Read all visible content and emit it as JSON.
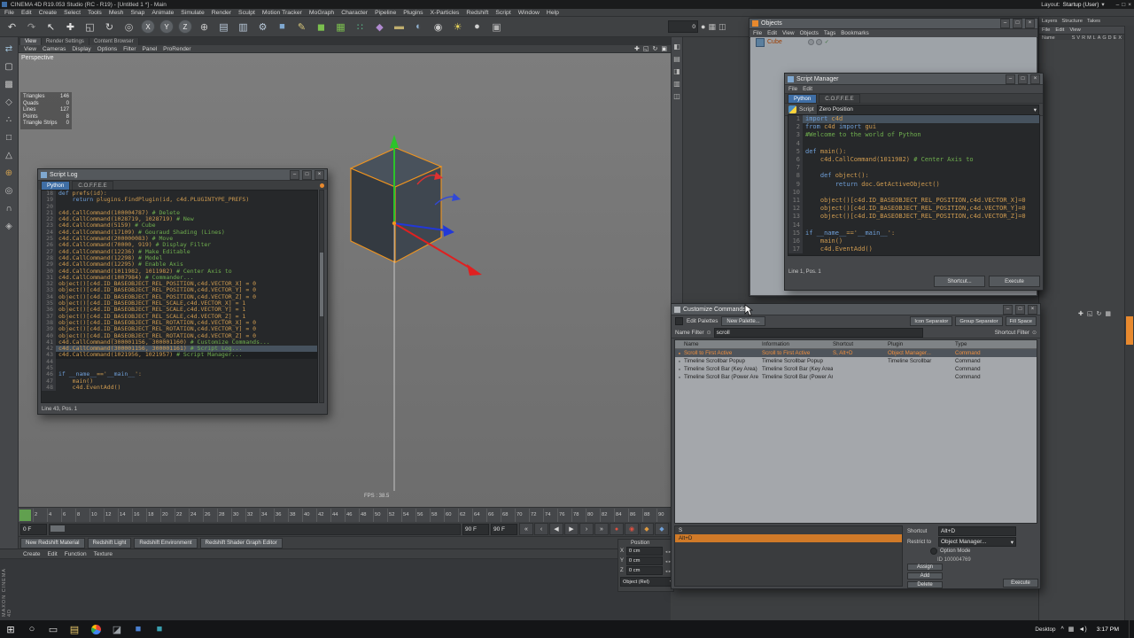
{
  "chrome": {
    "min": "–",
    "max": "□",
    "close": "×",
    "dropdown": "▾",
    "filter_icon": "⊙"
  },
  "titlebar": {
    "title": "CINEMA 4D R19.053 Studio (RC - R19) - [Untitled 1 *] - Main",
    "layout_label": "Layout:",
    "layout_value": "Startup (User)"
  },
  "menubar": {
    "items": [
      "File",
      "Edit",
      "Create",
      "Select",
      "Tools",
      "Mesh",
      "Snap",
      "Animate",
      "Simulate",
      "Render",
      "Sculpt",
      "Motion Tracker",
      "MoGraph",
      "Character",
      "Pipeline",
      "Plugins",
      "X-Particles",
      "Redshift",
      "Script",
      "Window",
      "Help"
    ]
  },
  "toolbar": {
    "icons": [
      {
        "name": "undo-icon",
        "glyph": "↶",
        "color": "#d8d8d8"
      },
      {
        "name": "redo-icon",
        "glyph": "↷",
        "color": "#9a9a9a"
      },
      {
        "name": "live-selection-icon",
        "glyph": "↖",
        "color": "#e8e8e8"
      },
      {
        "name": "move-tool-icon",
        "glyph": "✚",
        "color": "#e0e0e0"
      },
      {
        "name": "scale-tool-icon",
        "glyph": "◱",
        "color": "#d0d0d0"
      },
      {
        "name": "rotate-tool-icon",
        "glyph": "↻",
        "color": "#d0d0d0"
      },
      {
        "name": "last-tool-icon",
        "glyph": "◎",
        "color": "#c0c0c0"
      },
      {
        "name": "x-axis-toggle",
        "glyph": "X",
        "color": "#ececec",
        "cls": "round"
      },
      {
        "name": "y-axis-toggle",
        "glyph": "Y",
        "color": "#ececec",
        "cls": "round"
      },
      {
        "name": "z-axis-toggle",
        "glyph": "Z",
        "color": "#ececec",
        "cls": "round"
      },
      {
        "name": "coordinate-system-icon",
        "glyph": "⊕",
        "color": "#c8c8c8"
      },
      {
        "name": "render-view-icon",
        "glyph": "▤",
        "color": "#b8c8d8"
      },
      {
        "name": "render-picture-viewer-icon",
        "glyph": "▥",
        "color": "#b8c8d8"
      },
      {
        "name": "render-settings-icon",
        "glyph": "⚙",
        "color": "#b8c8d8"
      },
      {
        "name": "add-cube-icon",
        "glyph": "■",
        "color": "#7fa8d0"
      },
      {
        "name": "pen-tool-icon",
        "glyph": "✎",
        "color": "#d8c87a"
      },
      {
        "name": "subdivision-surface-icon",
        "glyph": "◼",
        "color": "#7bbf4e"
      },
      {
        "name": "array-generator-icon",
        "glyph": "▦",
        "color": "#7bbf4e"
      },
      {
        "name": "mograph-cloner-icon",
        "glyph": "∷",
        "color": "#5abf8e"
      },
      {
        "name": "deformer-icon",
        "glyph": "◆",
        "color": "#b08ad0"
      },
      {
        "name": "floor-object-icon",
        "glyph": "▬",
        "color": "#bfae6e"
      },
      {
        "name": "sky-object-icon",
        "glyph": "◐",
        "color": "#8fb0cf"
      },
      {
        "name": "camera-object-icon",
        "glyph": "◉",
        "color": "#c8c8c8"
      },
      {
        "name": "light-object-icon",
        "glyph": "☀",
        "color": "#e8d45a"
      },
      {
        "name": "material-icon",
        "glyph": "●",
        "color": "#d0d0d0"
      },
      {
        "name": "display-filter-icon",
        "glyph": "▣",
        "color": "#b0b0b0"
      }
    ],
    "right_value": "0",
    "right_icons": [
      {
        "name": "render-sphere-icon",
        "glyph": "●",
        "color": "#cfcfcf"
      },
      {
        "name": "grid-toggle-icon",
        "glyph": "▦",
        "color": "#b8b8b8"
      },
      {
        "name": "layout-toggle-icon",
        "glyph": "◫",
        "color": "#b8b8b8"
      }
    ]
  },
  "mode_palette": {
    "icons": [
      {
        "name": "make-editable-icon",
        "glyph": "⇄",
        "color": "#9fc0d8"
      },
      {
        "name": "model-mode-icon",
        "glyph": "▢",
        "color": "#d0d0d0"
      },
      {
        "name": "texture-mode-icon",
        "glyph": "▩",
        "color": "#c0c0c0"
      },
      {
        "name": "workplane-mode-icon",
        "glyph": "◇",
        "color": "#c0c0c0"
      },
      {
        "name": "points-mode-icon",
        "glyph": "∴",
        "color": "#d0d0d0"
      },
      {
        "name": "edges-mode-icon",
        "glyph": "□",
        "color": "#d0d0d0"
      },
      {
        "name": "polygons-mode-icon",
        "glyph": "△",
        "color": "#d0d0d0"
      },
      {
        "name": "enable-axis-icon",
        "glyph": "⊕",
        "color": "#d0a050"
      },
      {
        "name": "viewport-solo-icon",
        "glyph": "◎",
        "color": "#c0c0c0"
      },
      {
        "name": "snap-toggle-icon",
        "glyph": "∩",
        "color": "#d0d0d0"
      },
      {
        "name": "workplane-lock-icon",
        "glyph": "◈",
        "color": "#b0b0b0"
      }
    ]
  },
  "side_palette": {
    "icons": [
      {
        "name": "panel-toggle-icon-1",
        "glyph": "◧",
        "color": "#b8b8b8"
      },
      {
        "name": "panel-toggle-icon-2",
        "glyph": "▤",
        "color": "#b8b8b8"
      },
      {
        "name": "panel-toggle-icon-3",
        "glyph": "◨",
        "color": "#b8b8b8"
      },
      {
        "name": "panel-toggle-icon-4",
        "glyph": "▥",
        "color": "#b8b8b8"
      },
      {
        "name": "panel-toggle-icon-5",
        "glyph": "◫",
        "color": "#b8b8b8"
      }
    ]
  },
  "dock_tabs": {
    "items": [
      {
        "label": "View",
        "cls": "active"
      },
      {
        "label": "Render Settings"
      },
      {
        "label": "Content Browser"
      }
    ]
  },
  "viewport": {
    "menu": [
      "View",
      "Cameras",
      "Display",
      "Options",
      "Filter",
      "Panel",
      "ProRender"
    ],
    "label": "Perspective",
    "stats": [
      {
        "label": "Triangles",
        "value": "146"
      },
      {
        "label": "Quads",
        "value": "0"
      },
      {
        "label": "Lines",
        "value": "127"
      },
      {
        "label": "Points",
        "value": "8"
      },
      {
        "label": "Triangle Strips",
        "value": "0"
      }
    ],
    "fps": "FPS : 38.5",
    "nav_icons": [
      {
        "name": "pan-view-icon",
        "glyph": "✚"
      },
      {
        "name": "zoom-view-icon",
        "glyph": "◱"
      },
      {
        "name": "rotate-view-icon",
        "glyph": "↻"
      },
      {
        "name": "toggle-view-icon",
        "glyph": "▣"
      }
    ]
  },
  "timeline": {
    "ticks": [
      "0",
      "2",
      "4",
      "6",
      "8",
      "10",
      "12",
      "14",
      "16",
      "18",
      "20",
      "22",
      "24",
      "26",
      "28",
      "30",
      "32",
      "34",
      "36",
      "38",
      "40",
      "42",
      "44",
      "46",
      "48",
      "50",
      "52",
      "54",
      "56",
      "58",
      "60",
      "62",
      "64",
      "66",
      "68",
      "70",
      "72",
      "74",
      "76",
      "78",
      "80",
      "82",
      "84",
      "86",
      "88",
      "90"
    ]
  },
  "playback": {
    "current": "0 F",
    "end": "90 F",
    "end2": "90 F",
    "transport": [
      {
        "name": "goto-start-button",
        "glyph": "«",
        "color": "#d8d8d8"
      },
      {
        "name": "prev-key-button",
        "glyph": "‹",
        "color": "#d8d8d8"
      },
      {
        "name": "prev-frame-button",
        "glyph": "◀",
        "color": "#d8d8d8"
      },
      {
        "name": "play-forward-button",
        "glyph": "▶",
        "color": "#d8d8d8"
      },
      {
        "name": "next-frame-button",
        "glyph": "›",
        "color": "#d8d8d8"
      },
      {
        "name": "goto-end-button",
        "glyph": "»",
        "color": "#d8d8d8"
      },
      {
        "name": "record-keyframe-button",
        "glyph": "●",
        "color": "#e05040"
      },
      {
        "name": "autokey-button",
        "glyph": "◉",
        "color": "#e05040"
      },
      {
        "name": "keyframe-mode-button",
        "glyph": "◆",
        "color": "#e09a40"
      },
      {
        "name": "playback-options-button",
        "glyph": "◆",
        "color": "#6fa0d8"
      }
    ]
  },
  "redshift_bar": {
    "buttons": [
      "New Redshift Material",
      "Redshift Light",
      "Redshift Environment",
      "Redshift Shader Graph Editor"
    ]
  },
  "material_manager": {
    "menu": [
      "Create",
      "Edit",
      "Function",
      "Texture"
    ]
  },
  "brand": {
    "vertical": "MAXON  CINEMA 4D"
  },
  "coordinates": {
    "title": "Position",
    "rows": [
      {
        "axis": "X",
        "value": "0 cm"
      },
      {
        "axis": "Y",
        "value": "0 cm"
      },
      {
        "axis": "Z",
        "value": "0 cm"
      }
    ],
    "mode": "Object (Rel)"
  },
  "objects_panel": {
    "title": "Objects",
    "menu": [
      "File",
      "Edit",
      "View",
      "Objects",
      "Tags",
      "Bookmarks"
    ],
    "item": "Cube",
    "state_check": "✓"
  },
  "layers_panel": {
    "tabs": [
      "Layers",
      "Structure",
      "Takes"
    ],
    "menu": [
      "File",
      "Edit",
      "View"
    ],
    "name_header": "Name",
    "flags": [
      "S",
      "V",
      "R",
      "M",
      "L",
      "A",
      "G",
      "D",
      "E",
      "X"
    ],
    "nav_icons": [
      {
        "name": "pan-view-icon",
        "glyph": "✚"
      },
      {
        "name": "zoom-view-icon",
        "glyph": "◱"
      },
      {
        "name": "rotate-view-icon",
        "glyph": "↻"
      },
      {
        "name": "toggle-view-icon",
        "glyph": "▦"
      }
    ]
  },
  "script_log": {
    "title": "Script Log",
    "tabs": [
      {
        "label": "Python",
        "cls": "active"
      },
      {
        "label": "C.O.F.F.E.E"
      }
    ],
    "status": "Line 43, Pos. 1",
    "lines": [
      {
        "n": 18,
        "t": "def prefs(id):"
      },
      {
        "n": 19,
        "t": "    return plugins.FindPlugin(id, c4d.PLUGINTYPE_PREFS)"
      },
      {
        "n": 20,
        "t": ""
      },
      {
        "n": 21,
        "t": "c4d.CallCommand(100004787) # Delete"
      },
      {
        "n": 22,
        "t": "c4d.CallCommand(1028719, 1028719) # New"
      },
      {
        "n": 23,
        "t": "c4d.CallCommand(5159) # Cube"
      },
      {
        "n": 24,
        "t": "c4d.CallCommand(17109) # Gouraud Shading (Lines)"
      },
      {
        "n": 25,
        "t": "c4d.CallCommand(200000083) # Move"
      },
      {
        "n": 26,
        "t": "c4d.CallCommand(70000, 919) # Display Filter"
      },
      {
        "n": 27,
        "t": "c4d.CallCommand(12236) # Make Editable"
      },
      {
        "n": 28,
        "t": "c4d.CallCommand(12298) # Model"
      },
      {
        "n": 29,
        "t": "c4d.CallCommand(12295) # Enable Axis"
      },
      {
        "n": 30,
        "t": "c4d.CallCommand(1011982, 1011982) # Center Axis to"
      },
      {
        "n": 31,
        "t": "c4d.CallCommand(1007984) # Commander..."
      },
      {
        "n": 32,
        "t": "object()[c4d.ID_BASEOBJECT_REL_POSITION,c4d.VECTOR_X] = 0"
      },
      {
        "n": 33,
        "t": "object()[c4d.ID_BASEOBJECT_REL_POSITION,c4d.VECTOR_Y] = 0"
      },
      {
        "n": 34,
        "t": "object()[c4d.ID_BASEOBJECT_REL_POSITION,c4d.VECTOR_Z] = 0"
      },
      {
        "n": 35,
        "t": "object()[c4d.ID_BASEOBJECT_REL_SCALE,c4d.VECTOR_X] = 1"
      },
      {
        "n": 36,
        "t": "object()[c4d.ID_BASEOBJECT_REL_SCALE,c4d.VECTOR_Y] = 1"
      },
      {
        "n": 37,
        "t": "object()[c4d.ID_BASEOBJECT_REL_SCALE,c4d.VECTOR_Z] = 1"
      },
      {
        "n": 38,
        "t": "object()[c4d.ID_BASEOBJECT_REL_ROTATION,c4d.VECTOR_X] = 0"
      },
      {
        "n": 39,
        "t": "object()[c4d.ID_BASEOBJECT_REL_ROTATION,c4d.VECTOR_Y] = 0"
      },
      {
        "n": 40,
        "t": "object()[c4d.ID_BASEOBJECT_REL_ROTATION,c4d.VECTOR_Z] = 0"
      },
      {
        "n": 41,
        "t": "c4d.CallCommand(300001156, 300001160) # Customize Commands..."
      },
      {
        "n": 42,
        "t": "c4d.CallCommand(300001156, 300001161) # Script Log...",
        "cls": "sel"
      },
      {
        "n": 43,
        "t": "c4d.CallCommand(1021956, 1021957) # Script Manager...",
        "cls": "cur"
      },
      {
        "n": 44,
        "t": ""
      },
      {
        "n": 45,
        "t": ""
      },
      {
        "n": 46,
        "t": "if __name__=='__main__':"
      },
      {
        "n": 47,
        "t": "    main()"
      },
      {
        "n": 48,
        "t": "    c4d.EventAdd()"
      }
    ]
  },
  "script_manager": {
    "title": "Script Manager",
    "menu": [
      "File",
      "Edit"
    ],
    "tabs": [
      {
        "label": "Python",
        "cls": "active"
      },
      {
        "label": "C.O.F.F.E.E"
      }
    ],
    "script_label": "Script",
    "script_name": "Zero Position",
    "status": "Line 1, Pos. 1",
    "shortcut_btn": "Shortcut...",
    "execute_btn": "Execute",
    "lines": [
      {
        "n": 1,
        "t": "import c4d",
        "cls": "sel"
      },
      {
        "n": 2,
        "t": "from c4d import gui"
      },
      {
        "n": 3,
        "t": "#Welcome to the world of Python"
      },
      {
        "n": 4,
        "t": ""
      },
      {
        "n": 5,
        "t": "def main():"
      },
      {
        "n": 6,
        "t": "    c4d.CallCommand(1011982) # Center Axis to"
      },
      {
        "n": 7,
        "t": ""
      },
      {
        "n": 8,
        "t": "    def object():"
      },
      {
        "n": 9,
        "t": "        return doc.GetActiveObject()"
      },
      {
        "n": 10,
        "t": ""
      },
      {
        "n": 11,
        "t": "    object()[c4d.ID_BASEOBJECT_REL_POSITION,c4d.VECTOR_X]=0"
      },
      {
        "n": 12,
        "t": "    object()[c4d.ID_BASEOBJECT_REL_POSITION,c4d.VECTOR_Y]=0"
      },
      {
        "n": 13,
        "t": "    object()[c4d.ID_BASEOBJECT_REL_POSITION,c4d.VECTOR_Z]=0"
      },
      {
        "n": 14,
        "t": ""
      },
      {
        "n": 15,
        "t": "if __name__=='__main__':"
      },
      {
        "n": 16,
        "t": "    main()"
      },
      {
        "n": 17,
        "t": "    c4d.EventAdd()"
      }
    ]
  },
  "customize": {
    "title": "Customize Commands...",
    "edit_palettes_label": "Edit Palettes",
    "new_palette_btn": "New Palette...",
    "sep_buttons": [
      "Icon Separator",
      "Group Separator",
      "Fill Space"
    ],
    "name_filter_label": "Name Filter",
    "filter_value": "scroll",
    "shortcut_filter_label": "Shortcut Filter",
    "columns": [
      "Name",
      "Information",
      "Shortcut",
      "Plugin",
      "Type"
    ],
    "rows": [
      {
        "name": "Scroll to First Active",
        "info": "Scroll to First Active",
        "shortcut": "S, Alt+D",
        "plugin": "Object Manager...",
        "type": "Command",
        "cls": "selected"
      },
      {
        "name": "Timeline Scrollbar Popup",
        "info": "Timeline Scrollbar Popup",
        "shortcut": "",
        "plugin": "Timeline Scrollbar",
        "type": "Command"
      },
      {
        "name": "Timeline Scroll Bar (Key Area)",
        "info": "Timeline Scroll Bar (Key Area)",
        "shortcut": "",
        "plugin": "",
        "type": "Command"
      },
      {
        "name": "Timeline Scroll Bar (Power Are",
        "info": "Timeline Scroll Bar (Power Are",
        "shortcut": "",
        "plugin": "",
        "type": "Command"
      }
    ],
    "shortcut_list": [
      {
        "t": "S"
      },
      {
        "t": "Alt+D",
        "cls": "selected"
      }
    ],
    "shortcut_label": "Shortcut",
    "shortcut_value": "Alt+D",
    "restrict_label": "Restrict to",
    "restrict_value": "Object Manager...",
    "option_mode_label": "Option Mode",
    "id_label": "ID 100004769",
    "assign_btn": "Assign",
    "add_btn": "Add",
    "delete_btn": "Delete",
    "execute_btn": "Execute"
  },
  "taskbar": {
    "time": "3:17 PM",
    "desktop_label": "Desktop",
    "apps": [
      {
        "name": "start-button",
        "glyph": "⊞",
        "color": "#e8e8e8"
      },
      {
        "name": "search-icon",
        "glyph": "○",
        "color": "#d8d8d8"
      },
      {
        "name": "task-view-icon",
        "glyph": "▭",
        "color": "#d8d8d8"
      },
      {
        "name": "file-explorer-icon",
        "glyph": "▤",
        "color": "#e8c86a"
      },
      {
        "name": "chrome-icon",
        "glyph": "",
        "cls": "chrome"
      },
      {
        "name": "app-icon-dark",
        "glyph": "◪",
        "color": "#9aa0a6"
      },
      {
        "name": "app-icon-blue",
        "glyph": "■",
        "color": "#4a7fd0"
      },
      {
        "name": "app-icon-teal",
        "glyph": "■",
        "color": "#3aa0b0"
      }
    ],
    "tray": [
      {
        "name": "tray-expand-icon",
        "glyph": "^",
        "color": "#e8e8e8"
      },
      {
        "name": "touch-keyboard-icon",
        "glyph": "▦",
        "color": "#e0e0e0"
      },
      {
        "name": "volume-icon",
        "glyph": "◄)",
        "color": "#e0e0e0"
      }
    ]
  }
}
